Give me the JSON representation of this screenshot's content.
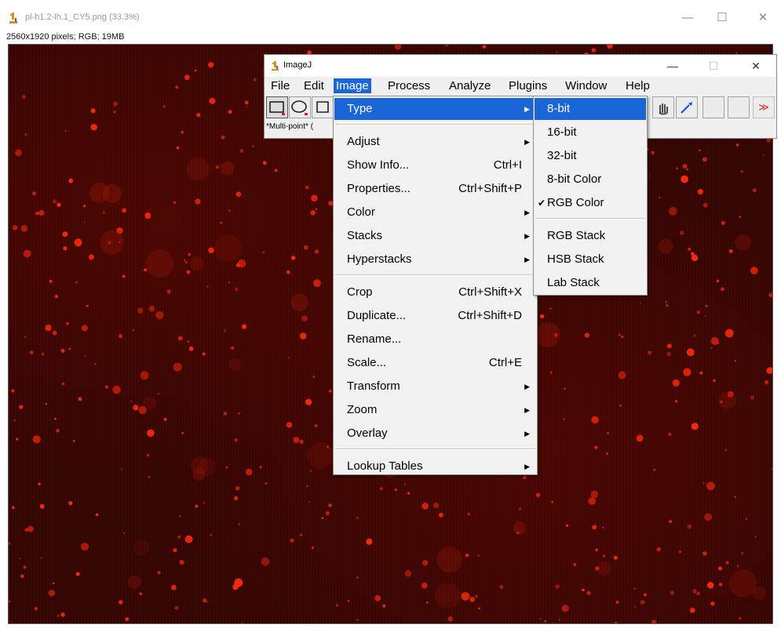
{
  "image_window": {
    "title": "pl-h1.2-lh.1_CY5.png (33.3%)",
    "info": "2560x1920 pixels; RGB; 19MB",
    "controls": {
      "minimize": "—",
      "maximize": "☐",
      "close": "✕"
    },
    "colors": {
      "background": "#340603",
      "spot": "#ff2a0a"
    }
  },
  "imagej": {
    "title": "ImageJ",
    "controls": {
      "minimize": "—",
      "maximize": "☐",
      "close": "✕"
    },
    "menubar": [
      "File",
      "Edit",
      "Image",
      "Process",
      "Analyze",
      "Plugins",
      "Window",
      "Help"
    ],
    "active_menu": "Image",
    "status": "*Multi-point* (",
    "toolbar_more": "≫",
    "accent_color": "#1a66d8"
  },
  "image_menu": {
    "items": [
      {
        "label": "Type",
        "shortcut": "",
        "submenu": true,
        "highlighted": true
      },
      {
        "separator": true
      },
      {
        "label": "Adjust",
        "shortcut": "",
        "submenu": true
      },
      {
        "label": "Show Info...",
        "shortcut": "Ctrl+I",
        "submenu": false
      },
      {
        "label": "Properties...",
        "shortcut": "Ctrl+Shift+P",
        "submenu": false
      },
      {
        "label": "Color",
        "shortcut": "",
        "submenu": true
      },
      {
        "label": "Stacks",
        "shortcut": "",
        "submenu": true
      },
      {
        "label": "Hyperstacks",
        "shortcut": "",
        "submenu": true
      },
      {
        "separator": true
      },
      {
        "label": "Crop",
        "shortcut": "Ctrl+Shift+X",
        "submenu": false
      },
      {
        "label": "Duplicate...",
        "shortcut": "Ctrl+Shift+D",
        "submenu": false
      },
      {
        "label": "Rename...",
        "shortcut": "",
        "submenu": false
      },
      {
        "label": "Scale...",
        "shortcut": "Ctrl+E",
        "submenu": false
      },
      {
        "label": "Transform",
        "shortcut": "",
        "submenu": true
      },
      {
        "label": "Zoom",
        "shortcut": "",
        "submenu": true
      },
      {
        "label": "Overlay",
        "shortcut": "",
        "submenu": true
      },
      {
        "separator": true
      },
      {
        "label": "Lookup Tables",
        "shortcut": "",
        "submenu": true
      }
    ]
  },
  "type_submenu": {
    "items": [
      {
        "label": "8-bit",
        "checked": false,
        "highlighted": true
      },
      {
        "label": "16-bit",
        "checked": false
      },
      {
        "label": "32-bit",
        "checked": false
      },
      {
        "label": "8-bit Color",
        "checked": false
      },
      {
        "label": "RGB Color",
        "checked": true
      },
      {
        "separator": true
      },
      {
        "label": "RGB Stack",
        "checked": false
      },
      {
        "label": "HSB Stack",
        "checked": false
      },
      {
        "label": "Lab Stack",
        "checked": false
      }
    ]
  }
}
